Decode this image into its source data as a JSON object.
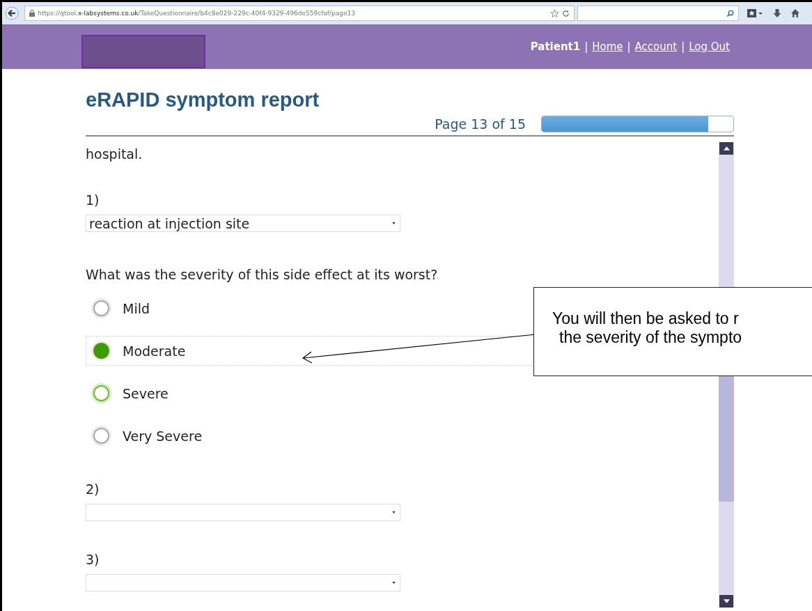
{
  "browser": {
    "url_prefix": "https://qtool.",
    "url_domain": "x-labsystems.co.uk",
    "url_path": "/TakeQuestionnaire/b4c8e029-229c-40f4-9329-496de559cfaf/page13"
  },
  "header": {
    "user": "Patient1",
    "links": [
      "Home",
      "Account",
      "Log Out"
    ],
    "separator": "|"
  },
  "title": "eRAPID symptom report",
  "progress": {
    "label": "Page 13 of 15",
    "level": 0.87
  },
  "intro_tail": "hospital.",
  "questions": [
    {
      "number": "1)",
      "value": "reaction at injection site",
      "prompt": "What was the severity of this side effect at its worst?",
      "options": [
        {
          "label": "Mild",
          "selected": false,
          "hovered": false
        },
        {
          "label": "Moderate",
          "selected": true,
          "hovered": false
        },
        {
          "label": "Severe",
          "selected": false,
          "hovered": true
        },
        {
          "label": "Very Severe",
          "selected": false,
          "hovered": false
        }
      ]
    },
    {
      "number": "2)"
    },
    {
      "number": "3)"
    }
  ],
  "callout": {
    "lines": [
      "You will then be asked to r",
      "the severity of the sympto"
    ]
  }
}
